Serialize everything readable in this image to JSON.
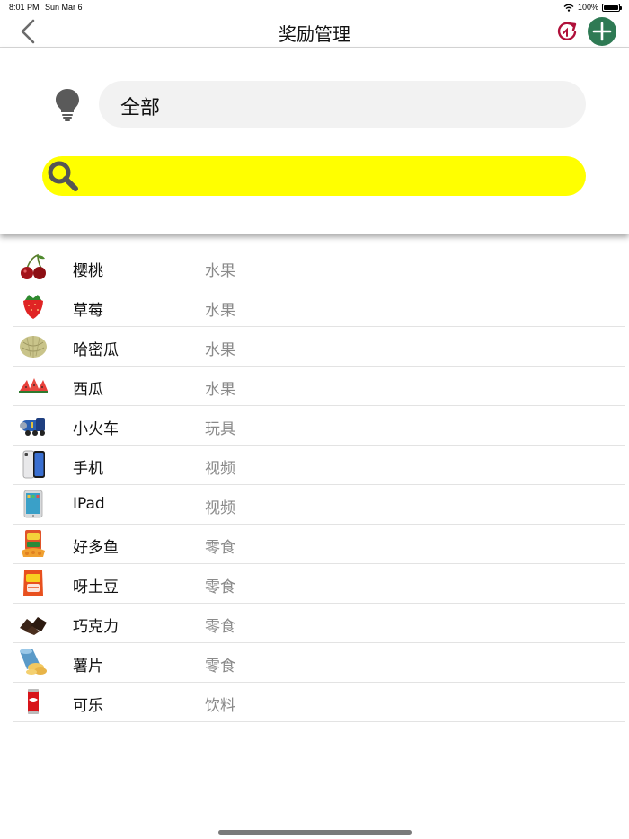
{
  "status_bar": {
    "time": "8:01 PM",
    "date": "Sun Mar 6",
    "battery": "100%"
  },
  "nav": {
    "title": "奖励管理"
  },
  "filter": {
    "category_value": "全部",
    "search_placeholder": ""
  },
  "colors": {
    "search_bar": "#ffff00",
    "add_button": "#2e7a54",
    "refresh_icon": "#b0103a"
  },
  "items": [
    {
      "name": "樱桃",
      "category": "水果",
      "icon": "cherry-icon"
    },
    {
      "name": "草莓",
      "category": "水果",
      "icon": "strawberry-icon"
    },
    {
      "name": "哈密瓜",
      "category": "水果",
      "icon": "melon-icon"
    },
    {
      "name": "西瓜",
      "category": "水果",
      "icon": "watermelon-icon"
    },
    {
      "name": "小火车",
      "category": "玩具",
      "icon": "toy-train-icon"
    },
    {
      "name": "手机",
      "category": "视频",
      "icon": "phone-icon"
    },
    {
      "name": "IPad",
      "category": "视频",
      "icon": "ipad-icon"
    },
    {
      "name": "好多鱼",
      "category": "零食",
      "icon": "snack-box-icon"
    },
    {
      "name": "呀土豆",
      "category": "零食",
      "icon": "chips-bag-icon"
    },
    {
      "name": "巧克力",
      "category": "零食",
      "icon": "chocolate-icon"
    },
    {
      "name": "薯片",
      "category": "零食",
      "icon": "potato-chips-icon"
    },
    {
      "name": "可乐",
      "category": "饮料",
      "icon": "cola-can-icon"
    }
  ]
}
